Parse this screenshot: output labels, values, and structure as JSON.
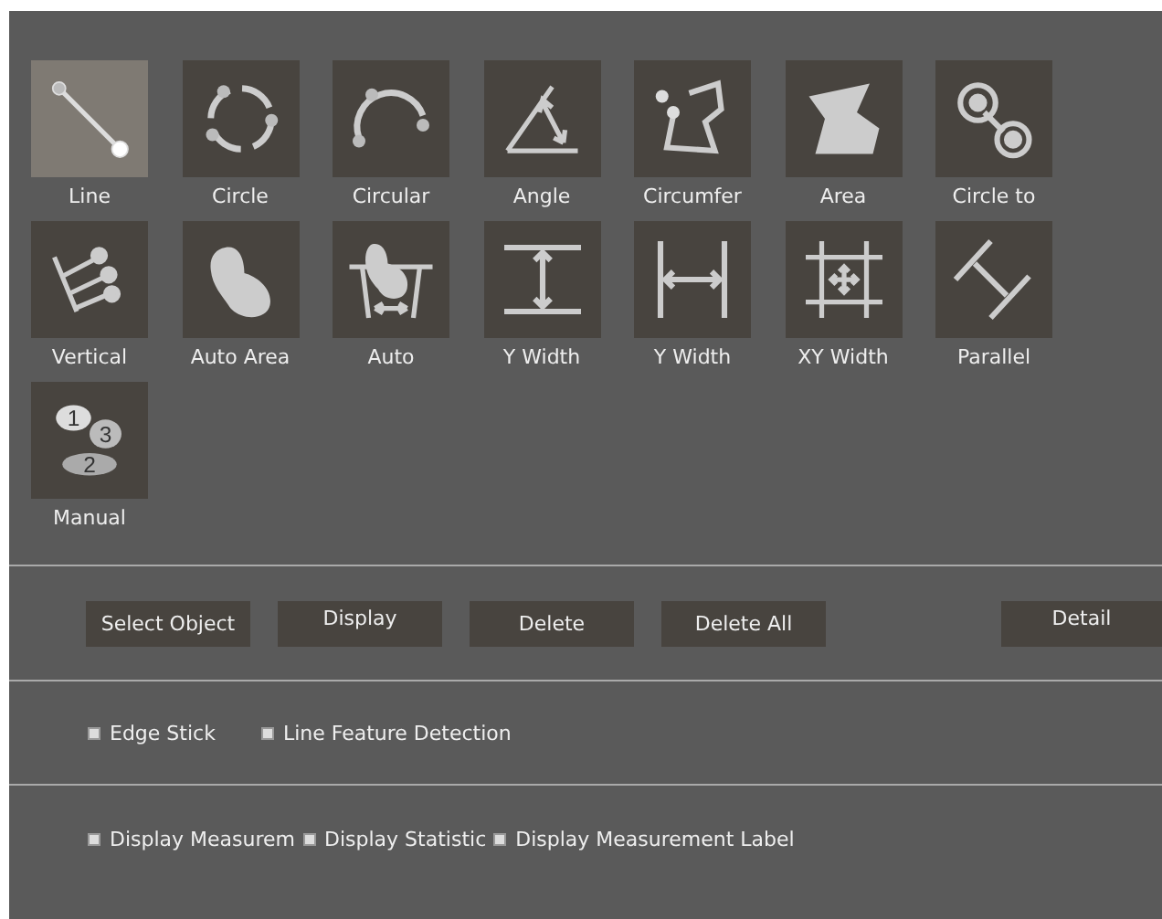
{
  "tools": [
    {
      "label": "Line",
      "kind": "line",
      "selected": true
    },
    {
      "label": "Circle",
      "kind": "circle",
      "selected": false
    },
    {
      "label": "Circular",
      "kind": "arc",
      "selected": false
    },
    {
      "label": "Angle",
      "kind": "angle",
      "selected": false
    },
    {
      "label": "Circumfer",
      "kind": "polyline",
      "selected": false
    },
    {
      "label": "Area",
      "kind": "area",
      "selected": false
    },
    {
      "label": "Circle to",
      "kind": "circle-to",
      "selected": false
    },
    {
      "label": "Vertical",
      "kind": "vertical",
      "selected": false
    },
    {
      "label": "Auto Area",
      "kind": "blob",
      "selected": false
    },
    {
      "label": "Auto",
      "kind": "auto",
      "selected": false
    },
    {
      "label": "Y Width",
      "kind": "y-width",
      "selected": false
    },
    {
      "label": "Y Width",
      "kind": "x-width",
      "selected": false
    },
    {
      "label": "XY Width",
      "kind": "xy-width",
      "selected": false
    },
    {
      "label": "Parallel",
      "kind": "parallel",
      "selected": false
    },
    {
      "label": "Manual",
      "kind": "manual",
      "selected": false,
      "digits": [
        "1",
        "3",
        "2"
      ]
    }
  ],
  "buttons": [
    {
      "label": "Select Object",
      "kind": "centered"
    },
    {
      "label": "Display",
      "kind": "raised"
    },
    {
      "label": "Delete",
      "kind": "centered"
    },
    {
      "label": "Delete All",
      "kind": "centered"
    },
    {
      "label": "Detail",
      "kind": "detail"
    }
  ],
  "options": [
    {
      "label": "Edge Stick",
      "checked": true
    },
    {
      "label": "Line Feature Detection",
      "checked": true
    }
  ],
  "display_options": [
    {
      "label": "Display Measurem",
      "checked": true
    },
    {
      "label": "Display Statistic",
      "checked": true
    },
    {
      "label": "Display Measurement Label",
      "checked": true
    }
  ]
}
